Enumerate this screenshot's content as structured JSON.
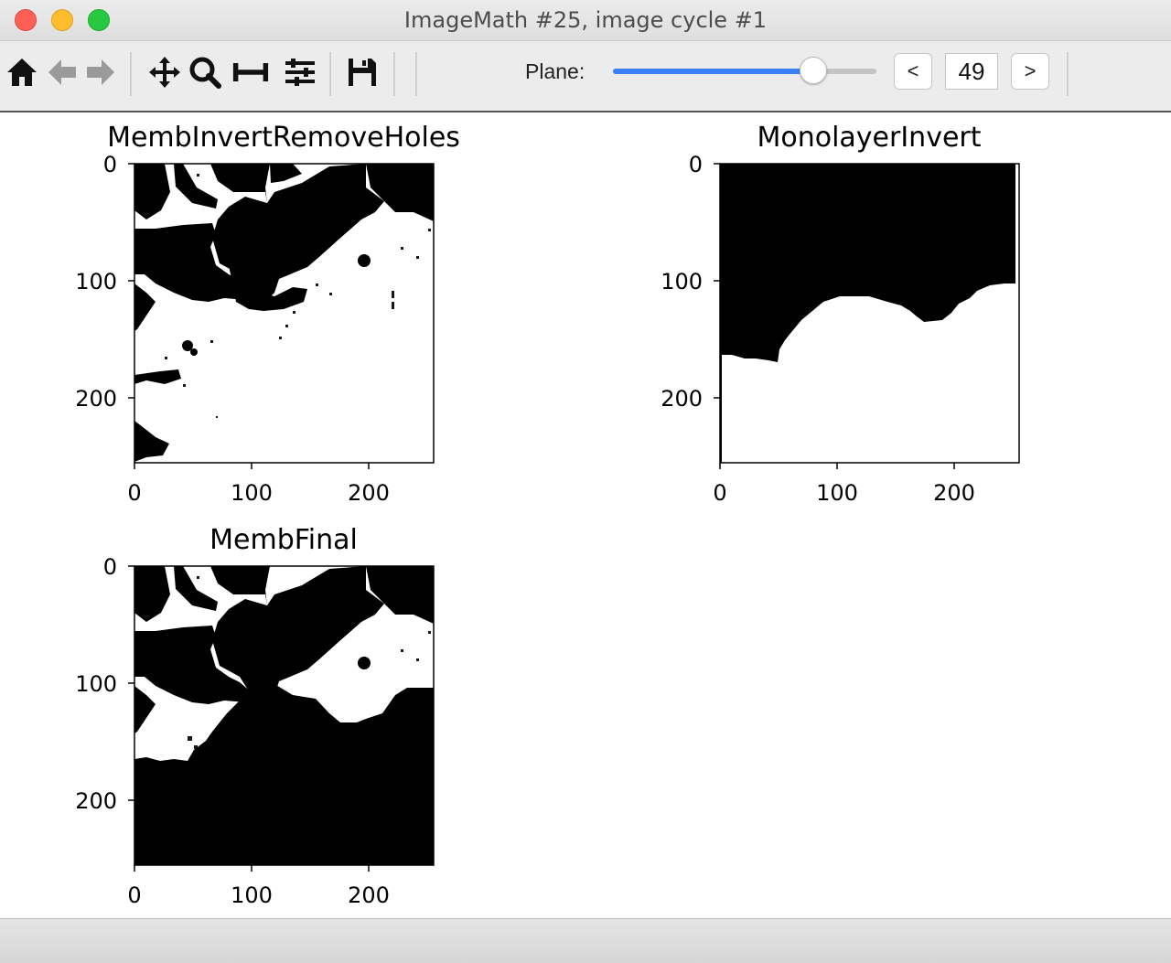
{
  "window": {
    "title": "ImageMath #25, image cycle #1"
  },
  "toolbar": {
    "icons": [
      "home-icon",
      "back-arrow-icon",
      "forward-arrow-icon",
      "pan-icon",
      "zoom-icon",
      "subplots-icon",
      "configure-icon",
      "save-icon"
    ],
    "plane_label": "Plane:",
    "plane_value": "49",
    "plane_fraction": 0.79,
    "prev_label": "<",
    "next_label": ">"
  },
  "plots": [
    {
      "title": "MembInvertRemoveHoles",
      "xticks": [
        "0",
        "100",
        "200"
      ],
      "yticks": [
        "0",
        "100",
        "200"
      ]
    },
    {
      "title": "MonolayerInvert",
      "xticks": [
        "0",
        "100",
        "200"
      ],
      "yticks": [
        "0",
        "100",
        "200"
      ]
    },
    {
      "title": "MembFinal",
      "xticks": [
        "0",
        "100",
        "200"
      ],
      "yticks": [
        "0",
        "100",
        "200"
      ]
    }
  ],
  "colors": {
    "slider_accent": "#3a7ff6",
    "foreground": "#000000",
    "background": "#ffffff"
  }
}
